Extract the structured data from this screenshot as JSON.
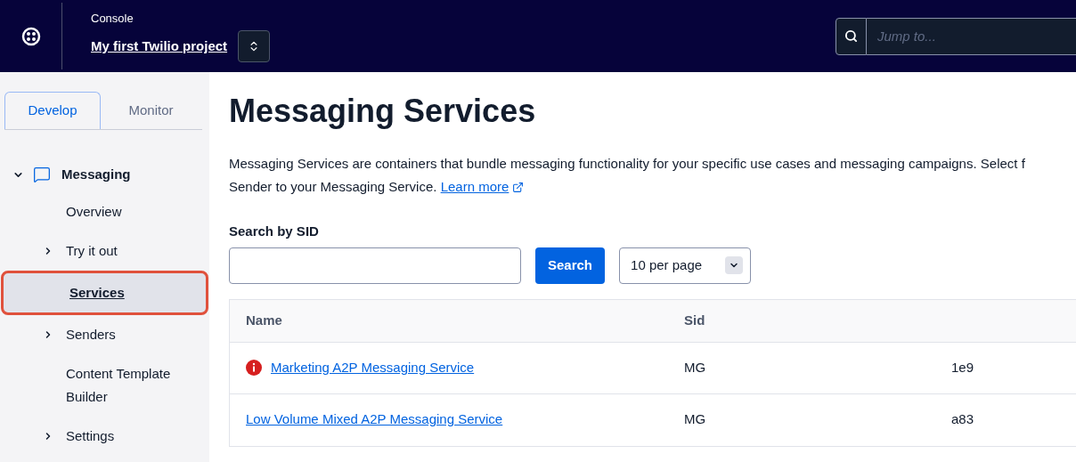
{
  "header": {
    "section": "Console",
    "project": "My first Twilio project",
    "search": {
      "placeholder": "Jump to..."
    }
  },
  "sidebar": {
    "tabs": [
      {
        "label": "Develop",
        "selected": true
      },
      {
        "label": "Monitor",
        "selected": false
      }
    ],
    "group": {
      "label": "Messaging",
      "expanded": true,
      "items": [
        {
          "label": "Overview",
          "expandable": false,
          "selected": false
        },
        {
          "label": "Try it out",
          "expandable": true,
          "selected": false
        },
        {
          "label": "Services",
          "expandable": false,
          "selected": true
        },
        {
          "label": "Senders",
          "expandable": true,
          "selected": false
        },
        {
          "label": "Content Template Builder",
          "expandable": false,
          "selected": false
        },
        {
          "label": "Settings",
          "expandable": true,
          "selected": false
        }
      ]
    }
  },
  "page": {
    "title": "Messaging Services",
    "description_lines": [
      "Messaging Services are containers that bundle messaging functionality for your specific use cases and messaging campaigns. Select f",
      "Sender to your Messaging Service."
    ],
    "learn_more": "Learn more",
    "search_label": "Search by SID",
    "search_button": "Search",
    "page_size": "10 per page",
    "table": {
      "columns": [
        "Name",
        "Sid"
      ],
      "rows": [
        {
          "name": "Marketing A2P Messaging Service",
          "warning": true,
          "sid_start": "MG",
          "sid_end": "1e9"
        },
        {
          "name": "Low Volume Mixed A2P Messaging Service",
          "warning": false,
          "sid_start": "MG",
          "sid_end": "a83"
        }
      ]
    }
  }
}
